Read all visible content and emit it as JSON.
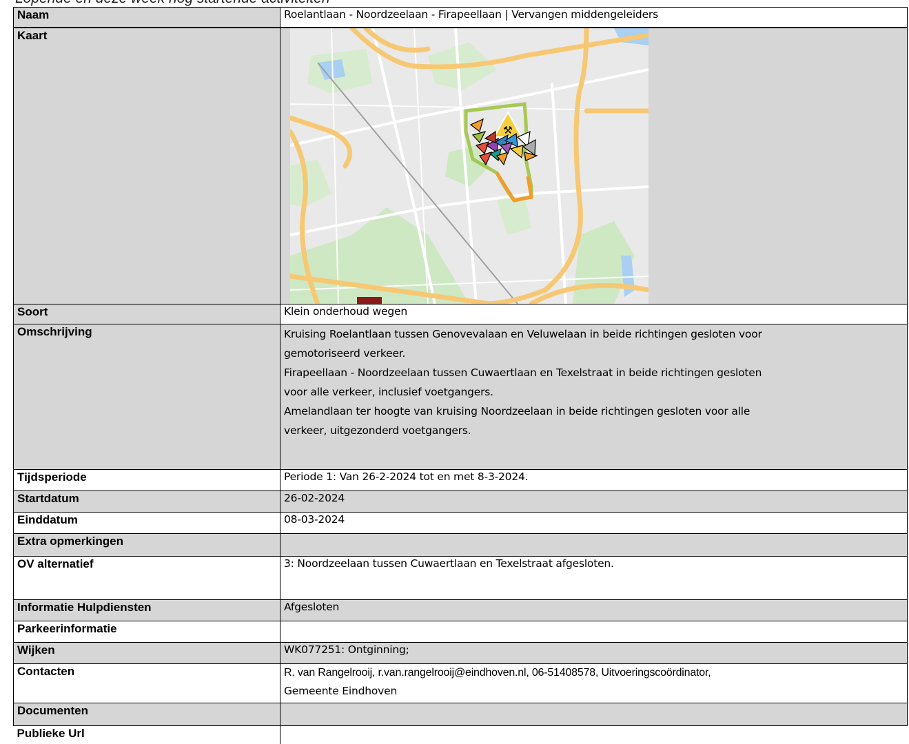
{
  "heading": "Lopende en deze week nog startende activiteiten",
  "rows": {
    "naam": {
      "label": "Naam",
      "value": "Roelantlaan - Noordzeelaan - Firapeellaan | Vervangen middengeleiders"
    },
    "kaart": {
      "label": "Kaart"
    },
    "soort": {
      "label": "Soort",
      "value": "Klein onderhoud wegen"
    },
    "omschrijving": {
      "label": "Omschrijving",
      "lines": [
        "Kruising Roelantlaan tussen Genovevalaan en Veluwelaan in beide richtingen gesloten voor",
        "gemotoriseerd verkeer.",
        "Firapeellaan - Noordzeelaan tussen Cuwaertlaan en Texelstraat in beide richtingen gesloten",
        "voor alle verkeer, inclusief voetgangers.",
        "Amelandlaan ter hoogte van kruising Noordzeelaan in beide richtingen gesloten voor alle",
        "verkeer, uitgezonderd voetgangers."
      ]
    },
    "tijdsperiode": {
      "label": "Tijdsperiode",
      "value": "Periode 1: Van 26-2-2024 tot en met 8-3-2024."
    },
    "startdatum": {
      "label": "Startdatum",
      "value": "26-02-2024"
    },
    "einddatum": {
      "label": "Einddatum",
      "value": "08-03-2024"
    },
    "extra": {
      "label": "Extra opmerkingen",
      "value": ""
    },
    "ov": {
      "label": "OV alternatief",
      "value": "3: Noordzeelaan tussen Cuwaertlaan en Texelstraat afgesloten."
    },
    "hulpdiensten": {
      "label": "Informatie Hulpdiensten",
      "value": "Afgesloten"
    },
    "parkeer": {
      "label": "Parkeerinformatie",
      "value": ""
    },
    "wijken": {
      "label": "Wijken",
      "value": "WK077251: Ontginning;"
    },
    "contacten": {
      "label": "Contacten",
      "line1": "R. van Rangelrooij, r.van.rangelrooij@eindhoven.nl, 06-51408578, Uitvoeringscoördinator,",
      "line2": "Gemeente Eindhoven"
    },
    "documenten": {
      "label": "Documenten",
      "value": ""
    },
    "url": {
      "label": "Publieke Url",
      "value": ""
    }
  },
  "colors": {
    "label_bg": "#d6d6d6",
    "map_bg": "#e9e9e9",
    "road": "#f7c873",
    "park": "#cfe8c4",
    "water": "#a9d0f0",
    "route_green": "#9cc23a",
    "route_orange": "#f39c2a"
  },
  "icons": [
    "roadwork-warning-icon",
    "detour-arrow-icons"
  ]
}
